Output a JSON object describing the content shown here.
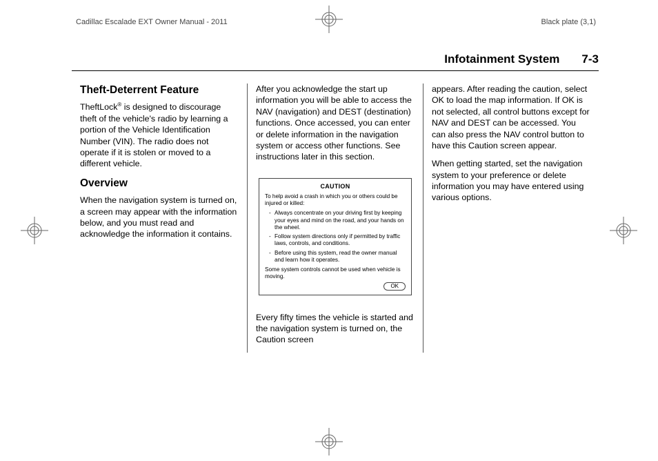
{
  "meta": {
    "manual_title": "Cadillac Escalade EXT Owner Manual - 2011",
    "plate": "Black plate (3,1)"
  },
  "running": {
    "section": "Infotainment System",
    "page": "7-3"
  },
  "col1": {
    "h_theft": "Theft-Deterrent Feature",
    "p_theft": "TheftLock",
    "p_theft_after": " is designed to discourage theft of the vehicle's radio by learning a portion of the Vehicle Identification Number (VIN). The radio does not operate if it is stolen or moved to a different vehicle.",
    "reg_mark": "®",
    "h_overview": "Overview",
    "p_overview": "When the navigation system is turned on, a screen may appear with the information below, and you must read and acknowledge the information it contains."
  },
  "col2": {
    "p_top": "After you acknowledge the start up information you will be able to access the NAV (navigation) and DEST (destination) functions. Once accessed, you can enter or delete information in the navigation system or access other functions. See instructions later in this section.",
    "caution": {
      "title": "CAUTION",
      "lead": "To help avoid a crash in which you or others could be injured or killed:",
      "items": [
        "Always concentrate on your driving first by keeping your eyes and mind on the road, and your hands on the wheel.",
        "Follow system directions only if permitted by traffic laws, controls, and conditions.",
        "Before using this system, read the owner manual and learn how it operates."
      ],
      "note": "Some system controls cannot be used when vehicle is moving.",
      "ok": "OK"
    },
    "p_bottom": "Every fifty times the vehicle is started and the navigation system is turned on, the Caution screen"
  },
  "col3": {
    "p1": "appears. After reading the caution, select OK to load the map information. If OK is not selected, all control buttons except for NAV and DEST can be accessed. You can also press the NAV control button to have this Caution screen appear.",
    "p2": "When getting started, set the navigation system to your preference or delete information you may have entered using various options."
  }
}
